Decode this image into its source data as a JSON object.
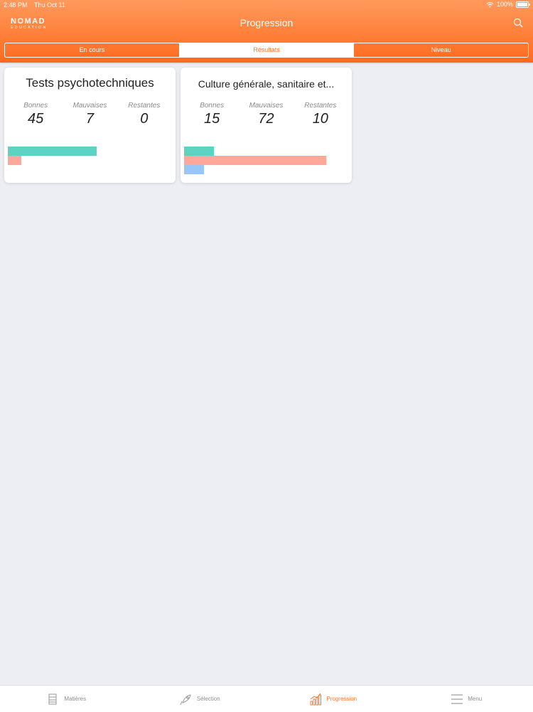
{
  "status_bar": {
    "time": "2:48 PM",
    "day": "Thu Oct 11",
    "battery": "100%"
  },
  "logo": {
    "main": "NOMAD",
    "sub": "EDUCATION"
  },
  "header": {
    "title": "Progression"
  },
  "segments": [
    {
      "label": "En cours",
      "active": false
    },
    {
      "label": "Résultats",
      "active": true
    },
    {
      "label": "Niveau",
      "active": false
    }
  ],
  "cards": [
    {
      "title": "Tests psychotechniques",
      "bonnes_label": "Bonnes",
      "bonnes": 45,
      "mauvaises_label": "Mauvaises",
      "mauvaises": 7,
      "restantes_label": "Restantes",
      "restantes": 0
    },
    {
      "title": "Culture générale, sanitaire et...",
      "bonnes_label": "Bonnes",
      "bonnes": 15,
      "mauvaises_label": "Mauvaises",
      "mauvaises": 72,
      "restantes_label": "Restantes",
      "restantes": 10
    }
  ],
  "tabbar": [
    {
      "label": "Matières",
      "icon": "books-icon",
      "active": false
    },
    {
      "label": "Sélection",
      "icon": "rocket-icon",
      "active": false
    },
    {
      "label": "Progression",
      "icon": "chart-icon",
      "active": true
    },
    {
      "label": "Menu",
      "icon": "menu-icon",
      "active": false
    }
  ],
  "colors": {
    "accent": "#ff7a2e",
    "good": "#5dd3c3",
    "bad": "#ffa89a",
    "remaining": "#98c7f7"
  }
}
